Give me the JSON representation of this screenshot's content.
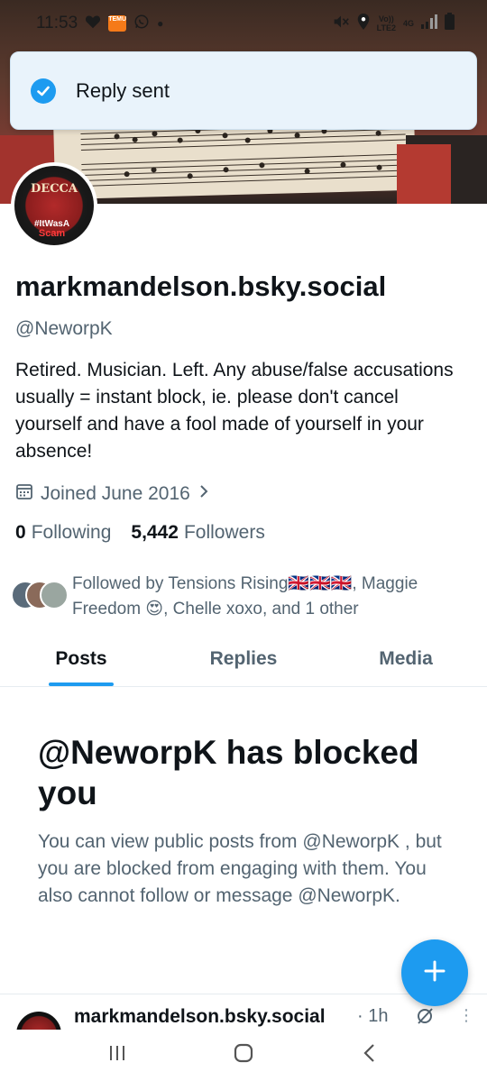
{
  "status_bar": {
    "time": "11:53",
    "temu_label": "TEMU",
    "network_label_top": "Vo))",
    "network_label_bottom": "LTE2",
    "network_type": "4G"
  },
  "toast": {
    "message": "Reply sent",
    "icon": "check-circle-icon"
  },
  "profile": {
    "display_name": "markmandelson.bsky.social",
    "handle": "@NeworpK",
    "bio": "Retired. Musician. Left. Any abuse/false accusations usually = instant block, ie. please don't cancel yourself and have a fool made of yourself in your absence!",
    "joined": "Joined June 2016",
    "following_count": "0",
    "following_label": "Following",
    "followers_count": "5,442",
    "followers_label": "Followers",
    "followed_by": "Followed by Tensions Rising🇬🇧🇬🇧🇬🇧, Maggie Freedom 😍, Chelle xoxo, and 1 other",
    "avatar_text_top": "DECCA",
    "avatar_text_tag": "#ItWasA",
    "avatar_text_bottom": "Scam"
  },
  "tabs": [
    {
      "label": "Posts",
      "active": true
    },
    {
      "label": "Replies",
      "active": false
    },
    {
      "label": "Media",
      "active": false
    }
  ],
  "blocked": {
    "title": "@NeworpK has blocked you",
    "description": "You can view public posts from @NeworpK , but you are blocked from engaging with them. You also cannot follow or message @NeworpK."
  },
  "post_preview": {
    "name": "markmandelson.bsky.social",
    "time": "· 1h",
    "more": "⋮"
  },
  "colors": {
    "accent": "#1d9bf0",
    "secondary_text": "#536471",
    "primary_text": "#0f1419"
  }
}
